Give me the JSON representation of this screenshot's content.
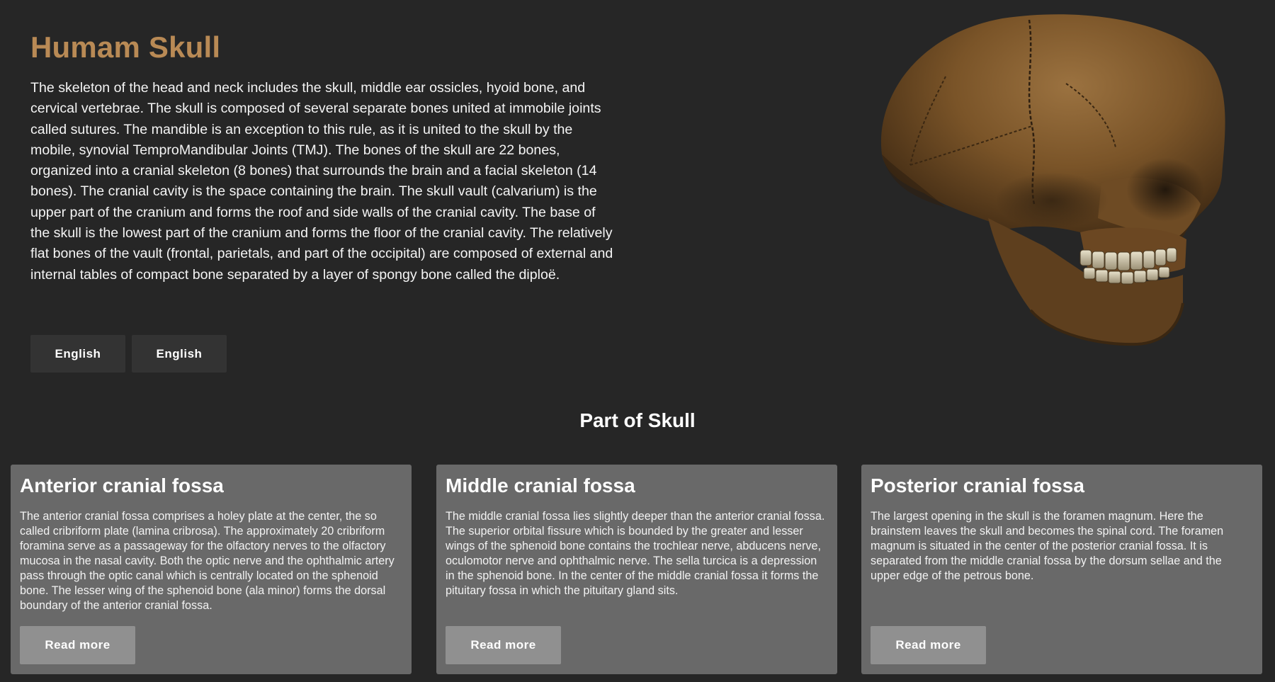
{
  "hero": {
    "title": "Humam Skull",
    "description": "The skeleton of the head and neck includes the skull, middle ear ossicles, hyoid bone, and cervical vertebrae. The skull is composed of several separate bones united at immobile joints called sutures. The mandible is an exception to this rule, as it is united to the skull by the mobile, synovial TemproMandibular Joints (TMJ). The bones of the skull are 22 bones, organized into a cranial skeleton (8 bones) that surrounds the brain and a facial skeleton (14 bones). The cranial cavity is the space containing the brain. The skull vault (calvarium) is the upper part of the cranium and forms the roof and side walls of the cranial cavity. The base of the skull is the lowest part of the cranium and forms the floor of the cranial cavity. The relatively flat bones of the vault (frontal, parietals, and part of the occipital) are composed of external and internal tables of compact bone separated by a layer of spongy bone called the diploë.",
    "buttons": [
      "English",
      "English"
    ]
  },
  "section": {
    "title": "Part of Skull"
  },
  "cards": [
    {
      "title": "Anterior cranial fossa",
      "text": "The anterior cranial fossa comprises a holey plate at the center, the so called cribriform plate (lamina cribrosa). The approximately 20 cribriform foramina serve as a passageway for the olfactory nerves to the olfactory mucosa in the nasal cavity. Both the optic nerve and the ophthalmic artery pass through the optic canal which is centrally located on the sphenoid bone. The lesser wing of the sphenoid bone (ala minor) forms the dorsal boundary of the anterior cranial fossa.",
      "button": "Read more"
    },
    {
      "title": "Middle cranial fossa",
      "text": "The middle cranial fossa lies slightly deeper than the anterior cranial fossa. The superior orbital fissure which is bounded by the greater and lesser wings of the sphenoid bone contains the trochlear nerve, abducens nerve, oculomotor nerve and ophthalmic nerve. The sella turcica is a depression in the sphenoid bone. In the center of the middle cranial fossa it forms the pituitary fossa in which the pituitary gland sits.",
      "button": "Read more"
    },
    {
      "title": "Posterior cranial fossa",
      "text": "The largest opening in the skull is the foramen magnum. Here the brainstem leaves the skull and becomes the spinal cord. The foramen magnum is situated in the center of the posterior cranial fossa. It is separated from the middle cranial fossa by the dorsum sellae and the upper edge of the petrous bone.",
      "button": "Read more"
    }
  ],
  "colors": {
    "background": "#262626",
    "title_accent": "#b98a55",
    "card_bg": "#696969",
    "card_button": "#909090",
    "lang_button": "#333333"
  },
  "images": {
    "hero_image": "skull-3d-render"
  }
}
